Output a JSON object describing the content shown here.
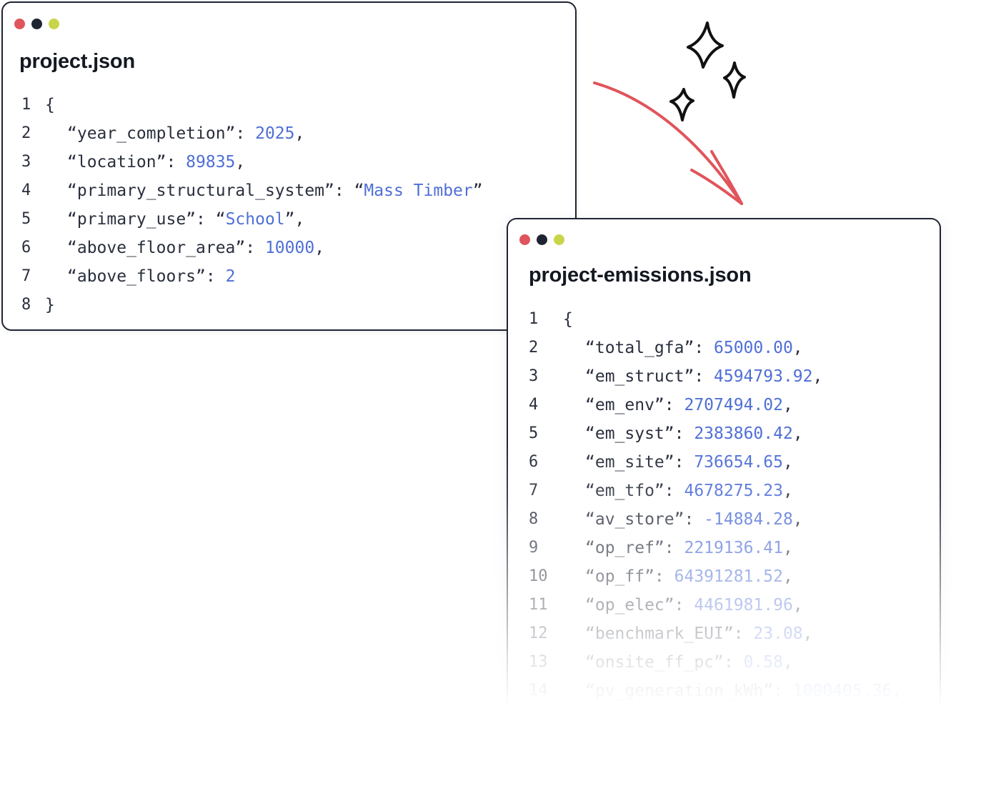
{
  "colors": {
    "window_border": "#1f2433",
    "dot_red": "#e0545b",
    "dot_navy": "#1f2433",
    "dot_lime": "#c8d54a",
    "value_blue": "#4f6fd6",
    "key_text": "#2a2f3d",
    "arrow": "#e0545b"
  },
  "icons": {
    "arrow": "curved-arrow-icon",
    "sparkles": "sparkles-icon"
  },
  "input_file": {
    "title": "project.json",
    "lines": [
      {
        "n": "1",
        "key": "{",
        "value": "",
        "suffix": "",
        "indent": 0
      },
      {
        "n": "2",
        "key": "“year_completion”: ",
        "value": "2025",
        "suffix": ",",
        "indent": 1
      },
      {
        "n": "3",
        "key": "“location”: ",
        "value": "89835",
        "suffix": ",",
        "indent": 1
      },
      {
        "n": "4",
        "key": "“primary_structural_system”: “",
        "value": "Mass Timber",
        "suffix": "”",
        "indent": 1
      },
      {
        "n": "5",
        "key": "“primary_use”: “",
        "value": "School",
        "suffix": "”,",
        "indent": 1
      },
      {
        "n": "6",
        "key": "“above_floor_area”: ",
        "value": "10000",
        "suffix": ",",
        "indent": 1
      },
      {
        "n": "7",
        "key": "“above_floors”: ",
        "value": "2",
        "suffix": "",
        "indent": 1
      },
      {
        "n": "8",
        "key": "}",
        "value": "",
        "suffix": "",
        "indent": 0
      }
    ]
  },
  "output_file": {
    "title": "project-emissions.json",
    "lines": [
      {
        "n": "1",
        "key": "{",
        "value": "",
        "suffix": "",
        "indent": 0
      },
      {
        "n": "2",
        "key": "“total_gfa”: ",
        "value": "65000.00",
        "suffix": ",",
        "indent": 1
      },
      {
        "n": "3",
        "key": "“em_struct”: ",
        "value": "4594793.92",
        "suffix": ",",
        "indent": 1
      },
      {
        "n": "4",
        "key": "“em_env”: ",
        "value": "2707494.02",
        "suffix": ",",
        "indent": 1
      },
      {
        "n": "5",
        "key": "“em_syst”: ",
        "value": "2383860.42",
        "suffix": ",",
        "indent": 1
      },
      {
        "n": "6",
        "key": "“em_site”: ",
        "value": "736654.65",
        "suffix": ",",
        "indent": 1
      },
      {
        "n": "7",
        "key": "“em_tfo”: ",
        "value": "4678275.23",
        "suffix": ",",
        "indent": 1
      },
      {
        "n": "8",
        "key": "“av_store”: ",
        "value": "-14884.28",
        "suffix": ",",
        "indent": 1
      },
      {
        "n": "9",
        "key": "“op_ref”: ",
        "value": "2219136.41",
        "suffix": ",",
        "indent": 1
      },
      {
        "n": "10",
        "key": "“op_ff”: ",
        "value": "64391281.52",
        "suffix": ",",
        "indent": 1
      },
      {
        "n": "11",
        "key": "“op_elec”: ",
        "value": "4461981.96",
        "suffix": ",",
        "indent": 1
      },
      {
        "n": "12",
        "key": "“benchmark_EUI”: ",
        "value": "23.08",
        "suffix": ",",
        "indent": 1
      },
      {
        "n": "13",
        "key": "“onsite_ff_pc”: ",
        "value": "0.58",
        "suffix": ",",
        "indent": 1
      },
      {
        "n": "14",
        "key": "“pv_generation_kWh”: ",
        "value": "1000405.36",
        "suffix": ",",
        "indent": 1
      }
    ]
  }
}
